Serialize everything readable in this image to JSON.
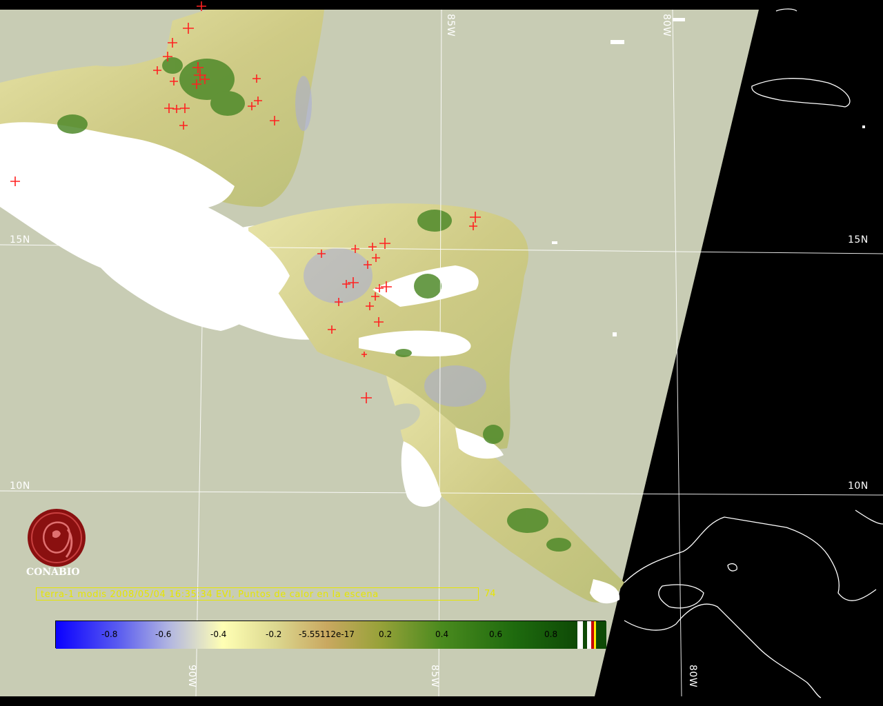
{
  "map": {
    "grid_labels": {
      "lon_85w_top": "85W",
      "lon_80w_top": "80W",
      "lat_15n_left": "15N",
      "lat_15n_right": "15N",
      "lat_10n_left": "10N",
      "lat_10n_right": "10N",
      "lon_90w_bottom": "90W",
      "lon_85w_bottom": "85W",
      "lon_80w_bottom": "80W"
    },
    "colors": {
      "background_scene": "#c8ccb4",
      "outside_scene": "#000000",
      "cloud_mask": "#ffffff",
      "vegetation_low": "#d8d48a",
      "vegetation_high": "#3f7f1f",
      "water_stress": "#9aa0d0",
      "fire_marker": "#ff2020",
      "grid_line": "#ffffff",
      "caption": "#e6e600"
    }
  },
  "logo": {
    "name": "CONABIO"
  },
  "caption": {
    "text": "terra-1 modis 2008/05/04 16:35:34 EVI, Puntos de calor en la escena",
    "count": "74"
  },
  "colorbar": {
    "labels": [
      "-0.8",
      "-0.6",
      "-0.4",
      "-0.2",
      "-5.55112e-17",
      "0.2",
      "0.4",
      "0.6",
      "0.8"
    ]
  }
}
